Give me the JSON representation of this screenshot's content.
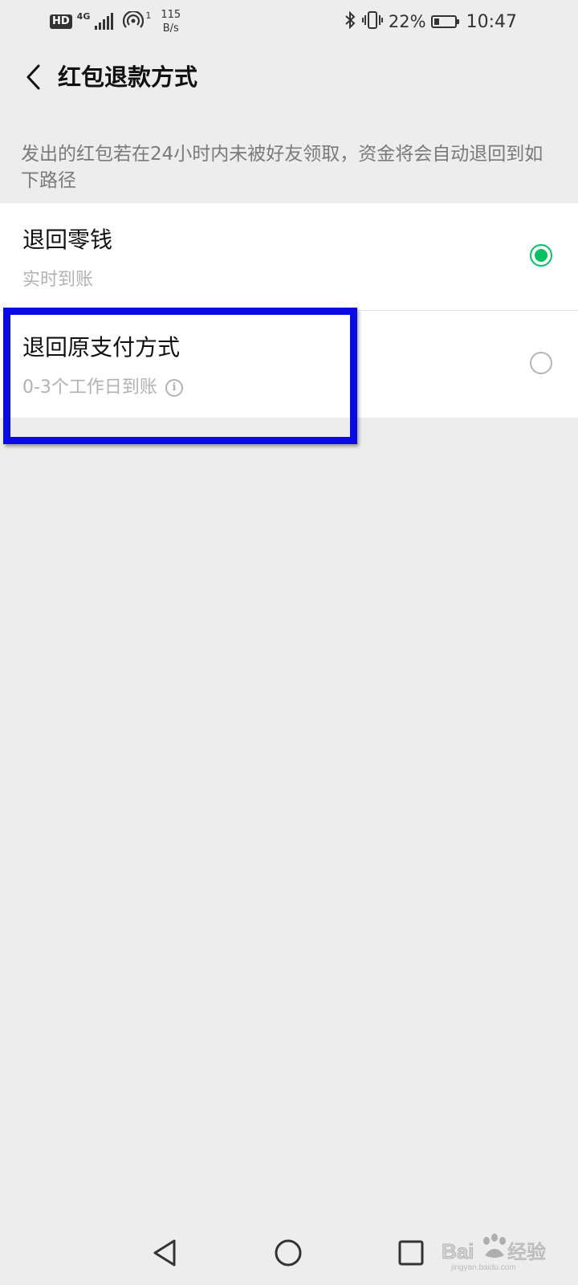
{
  "status_bar": {
    "hd": "HD",
    "network_type": "4G",
    "hotspot_count": "1",
    "speed_value": "115",
    "speed_unit": "B/s",
    "battery_percent": "22%",
    "time": "10:47",
    "icons": [
      "signal-icon",
      "hotspot-icon",
      "bluetooth-icon",
      "vibrate-icon",
      "battery-charging-icon"
    ]
  },
  "header": {
    "back_icon": "chevron-left-icon",
    "title": "红包退款方式"
  },
  "description": "发出的红包若在24小时内未被好友领取，资金将会自动退回到如下路径",
  "options": [
    {
      "title": "退回零钱",
      "subtitle": "实时到账",
      "selected": true
    },
    {
      "title": "退回原支付方式",
      "subtitle": "0-3个工作日到账",
      "selected": false,
      "info_icon": "info-icon",
      "info_glyph": "i"
    }
  ],
  "nav_bar": {
    "icons": [
      "back-triangle-icon",
      "home-circle-icon",
      "recents-square-icon"
    ]
  },
  "watermark": {
    "text": "Bai经验",
    "subtext": "jingyan.baidu.com"
  },
  "colors": {
    "background": "#ededed",
    "accent": "#07c160",
    "highlight": "#0a0ae6"
  }
}
